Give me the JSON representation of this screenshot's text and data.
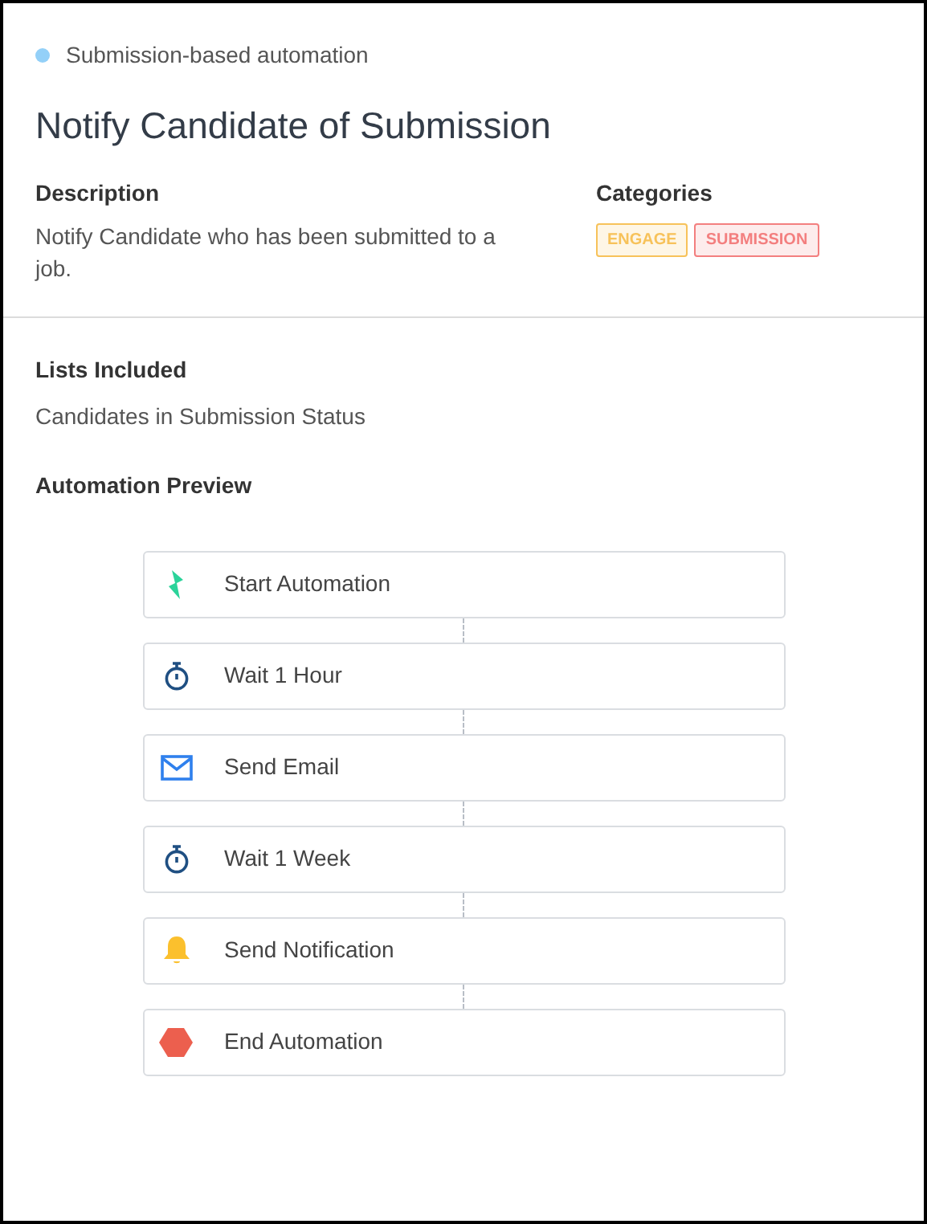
{
  "type_label": {
    "text": "Submission-based automation",
    "color": "#93d0f8"
  },
  "title": "Notify Candidate of Submission",
  "description": {
    "heading": "Description",
    "text": "Notify Candidate who has been submitted to a job."
  },
  "categories": {
    "heading": "Categories",
    "tags": [
      {
        "label": "ENGAGE",
        "color": "#f7c25a"
      },
      {
        "label": "SUBMISSION",
        "color": "#f37f7f"
      }
    ]
  },
  "lists_included": {
    "heading": "Lists Included",
    "text": "Candidates in Submission Status"
  },
  "automation_preview": {
    "heading": "Automation Preview",
    "steps": [
      {
        "kind": "start",
        "label": "Start Automation"
      },
      {
        "kind": "wait",
        "label": "Wait 1 Hour"
      },
      {
        "kind": "email",
        "label": "Send Email"
      },
      {
        "kind": "wait",
        "label": "Wait 1 Week"
      },
      {
        "kind": "notification",
        "label": "Send Notification"
      },
      {
        "kind": "end",
        "label": "End Automation"
      }
    ]
  }
}
